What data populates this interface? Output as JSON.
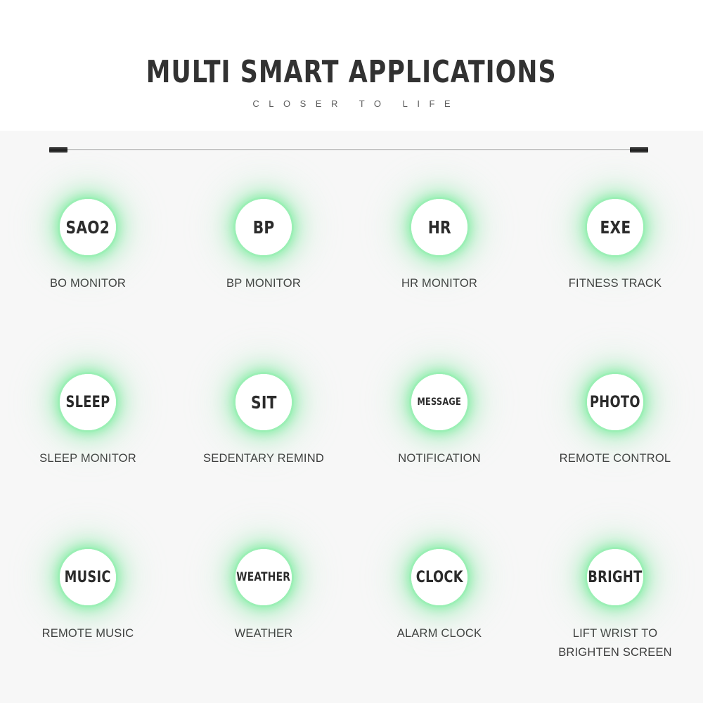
{
  "header": {
    "title": "MULTI SMART APPLICATIONS",
    "subtitle": "CLOSER TO LIFE",
    "band_background": "#ffffff"
  },
  "divider": {
    "left_cap": "",
    "right_cap": "",
    "line_color": "#bfbfbf",
    "cap_color": "#242424"
  },
  "theme": {
    "page_background": "#f7f7f7",
    "glow_color": "#8cecaa",
    "badge_background": "#ffffff",
    "badge_text_color": "#2b2b2b",
    "caption_text_color": "#3d3d3d"
  },
  "features": [
    {
      "badge": "SAO2",
      "badge_size": "size-lg",
      "caption": "BO MONITOR"
    },
    {
      "badge": "BP",
      "badge_size": "size-lg",
      "caption": "BP MONITOR"
    },
    {
      "badge": "HR",
      "badge_size": "size-lg",
      "caption": "HR MONITOR"
    },
    {
      "badge": "EXE",
      "badge_size": "size-lg",
      "caption": "FITNESS TRACK"
    },
    {
      "badge": "SLEEP",
      "badge_size": "size-md",
      "caption": "SLEEP MONITOR"
    },
    {
      "badge": "SIT",
      "badge_size": "size-lg",
      "caption": "SEDENTARY REMIND"
    },
    {
      "badge": "MESSAGE",
      "badge_size": "size-xs",
      "caption": "NOTIFICATION"
    },
    {
      "badge": "PHOTO",
      "badge_size": "size-md",
      "caption": "REMOTE CONTROL"
    },
    {
      "badge": "MUSIC",
      "badge_size": "size-md",
      "caption": "REMOTE MUSIC"
    },
    {
      "badge": "WEATHER",
      "badge_size": "size-sm",
      "caption": "WEATHER"
    },
    {
      "badge": "CLOCK",
      "badge_size": "size-md",
      "caption": "ALARM CLOCK"
    },
    {
      "badge": "BRIGHT",
      "badge_size": "size-md",
      "caption": "LIFT WRIST TO\nBRIGHTEN SCREEN"
    }
  ]
}
